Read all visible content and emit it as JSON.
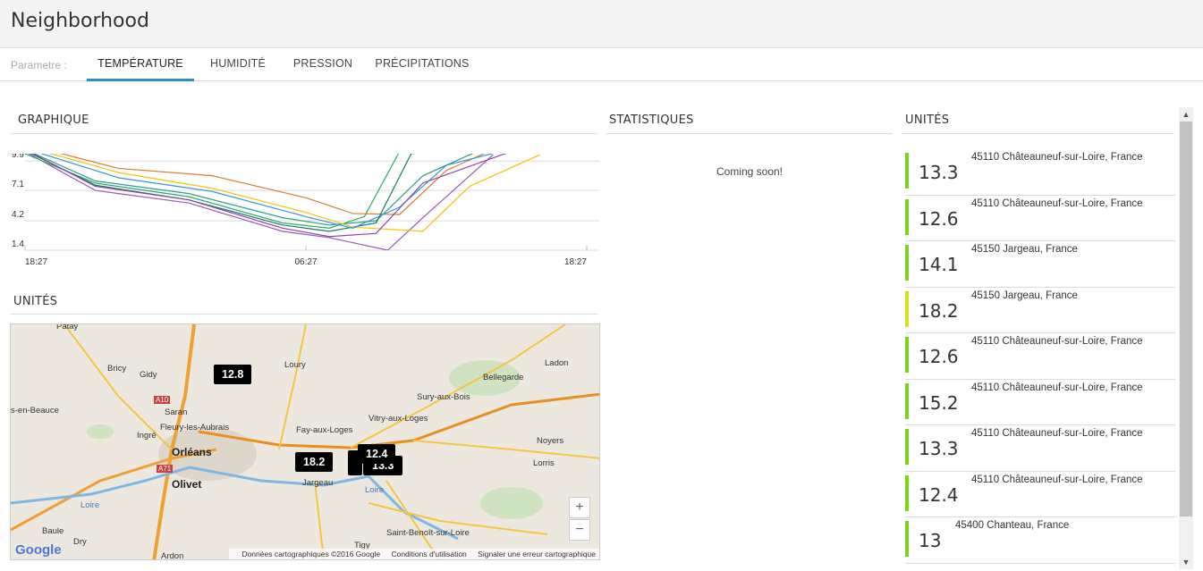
{
  "header": {
    "title": "Neighborhood"
  },
  "tabs": {
    "label": "Parametre :",
    "items": [
      {
        "label": "TEMPÉRATURE",
        "active": true
      },
      {
        "label": "HUMIDITÉ",
        "active": false
      },
      {
        "label": "PRESSION",
        "active": false
      },
      {
        "label": "PRÉCIPITATIONS",
        "active": false
      }
    ]
  },
  "sections": {
    "graphique": "GRAPHIQUE",
    "statistiques": "STATISTIQUES",
    "unites_right": "UNITÉS",
    "unites_left": "UNITÉS"
  },
  "statistiques": {
    "text": "Coming soon!"
  },
  "chart_data": {
    "type": "line",
    "y_ticks": [
      "9.9",
      "7.1",
      "4.2",
      "1.4"
    ],
    "y_tick_values": [
      9.9,
      7.1,
      4.2,
      1.4
    ],
    "x_ticks": [
      "18:27",
      "06:27",
      "18:27"
    ],
    "x_tick_values": [
      0,
      12,
      24
    ],
    "ylim": [
      1.4,
      10.6
    ],
    "xlim": [
      0,
      24
    ],
    "grid": true,
    "series": [
      {
        "color": "#e07b2a",
        "x": [
          0,
          4,
          8,
          12,
          14,
          16,
          18,
          20
        ],
        "y": [
          11.5,
          9.2,
          8.5,
          6.4,
          4.9,
          4.8,
          9.0,
          11.0
        ]
      },
      {
        "color": "#9b59b6",
        "x": [
          0,
          3,
          7,
          11,
          13,
          15.5,
          17,
          20
        ],
        "y": [
          10.8,
          7.1,
          5.9,
          3.2,
          2.6,
          1.4,
          4.5,
          10.5
        ]
      },
      {
        "color": "#2f9c8f",
        "x": [
          0,
          3,
          7,
          11,
          13,
          15,
          17,
          20
        ],
        "y": [
          11.0,
          8.0,
          6.8,
          4.5,
          3.8,
          4.2,
          8.5,
          11.5
        ]
      },
      {
        "color": "#27ae60",
        "x": [
          0,
          3,
          7,
          11,
          13,
          14.5,
          16,
          19
        ],
        "y": [
          10.6,
          7.8,
          6.5,
          4.0,
          3.5,
          4.6,
          10.8,
          11.5
        ]
      },
      {
        "color": "#1a7a63",
        "x": [
          0,
          3,
          7,
          11,
          13,
          15,
          16.5,
          20
        ],
        "y": [
          10.9,
          7.6,
          6.2,
          3.8,
          3.2,
          4.0,
          10.6,
          11.6
        ]
      },
      {
        "color": "#f1c40f",
        "x": [
          0,
          4,
          8,
          12,
          14,
          17,
          19,
          22
        ],
        "y": [
          11.3,
          8.8,
          7.3,
          5.0,
          3.6,
          3.2,
          7.5,
          10.5
        ]
      },
      {
        "color": "#3498db",
        "x": [
          0,
          4,
          8,
          12,
          14,
          16,
          18,
          21
        ],
        "y": [
          11.1,
          8.3,
          7.0,
          4.6,
          3.5,
          5.5,
          9.5,
          11.2
        ]
      },
      {
        "color": "#8e44ad",
        "x": [
          0,
          3,
          7,
          11,
          13,
          15,
          17,
          21
        ],
        "y": [
          11.0,
          7.5,
          6.2,
          3.5,
          2.7,
          3.0,
          7.8,
          11.0
        ]
      }
    ]
  },
  "map": {
    "towns": [
      "Patay",
      "Bricy",
      "Gidy",
      "Loury",
      "Ladon",
      "Bellegarde",
      "Sury-aux-Bois",
      "Saran",
      "Fleury-les-Aubrais",
      "s-en-Beauce",
      "Ingré",
      "Vitry-aux-Loges",
      "Fay-aux-Loges",
      "Orléans",
      "Noyers",
      "Lorris",
      "Olivet",
      "Jargeau",
      "Baule",
      "Dry",
      "Ardon",
      "Tigy",
      "Saint-Benoît-sur-Loire",
      "Loire",
      "Loire",
      "A10",
      "A71"
    ],
    "markers": [
      "12.8",
      "18.2",
      "13.3",
      "12.4"
    ],
    "zoom_in": "+",
    "zoom_out": "−",
    "footer": [
      "Données cartographiques ©2016 Google",
      "Conditions d'utilisation",
      "Signaler une erreur cartographique"
    ],
    "logo": "Google"
  },
  "units": [
    {
      "value": "13.3",
      "location": "45110 Châteauneuf-sur-Loire, France",
      "color": "#7ed321"
    },
    {
      "value": "12.6",
      "location": "45110 Châteauneuf-sur-Loire, France",
      "color": "#7ed321"
    },
    {
      "value": "14.1",
      "location": "45150 Jargeau, France",
      "color": "#7ed321"
    },
    {
      "value": "18.2",
      "location": "45150 Jargeau, France",
      "color": "#d4e21f"
    },
    {
      "value": "12.6",
      "location": "45110 Châteauneuf-sur-Loire, France",
      "color": "#7ed321"
    },
    {
      "value": "15.2",
      "location": "45110 Châteauneuf-sur-Loire, France",
      "color": "#7ed321"
    },
    {
      "value": "13.3",
      "location": "45110 Châteauneuf-sur-Loire, France",
      "color": "#7ed321"
    },
    {
      "value": "12.4",
      "location": "45110 Châteauneuf-sur-Loire, France",
      "color": "#7ed321"
    },
    {
      "value": "13",
      "location": "45400 Chanteau, France",
      "color": "#7ed321"
    }
  ],
  "scrollbar": {
    "up_icon": "chevron-up-icon",
    "down_icon": "chevron-down-icon"
  }
}
